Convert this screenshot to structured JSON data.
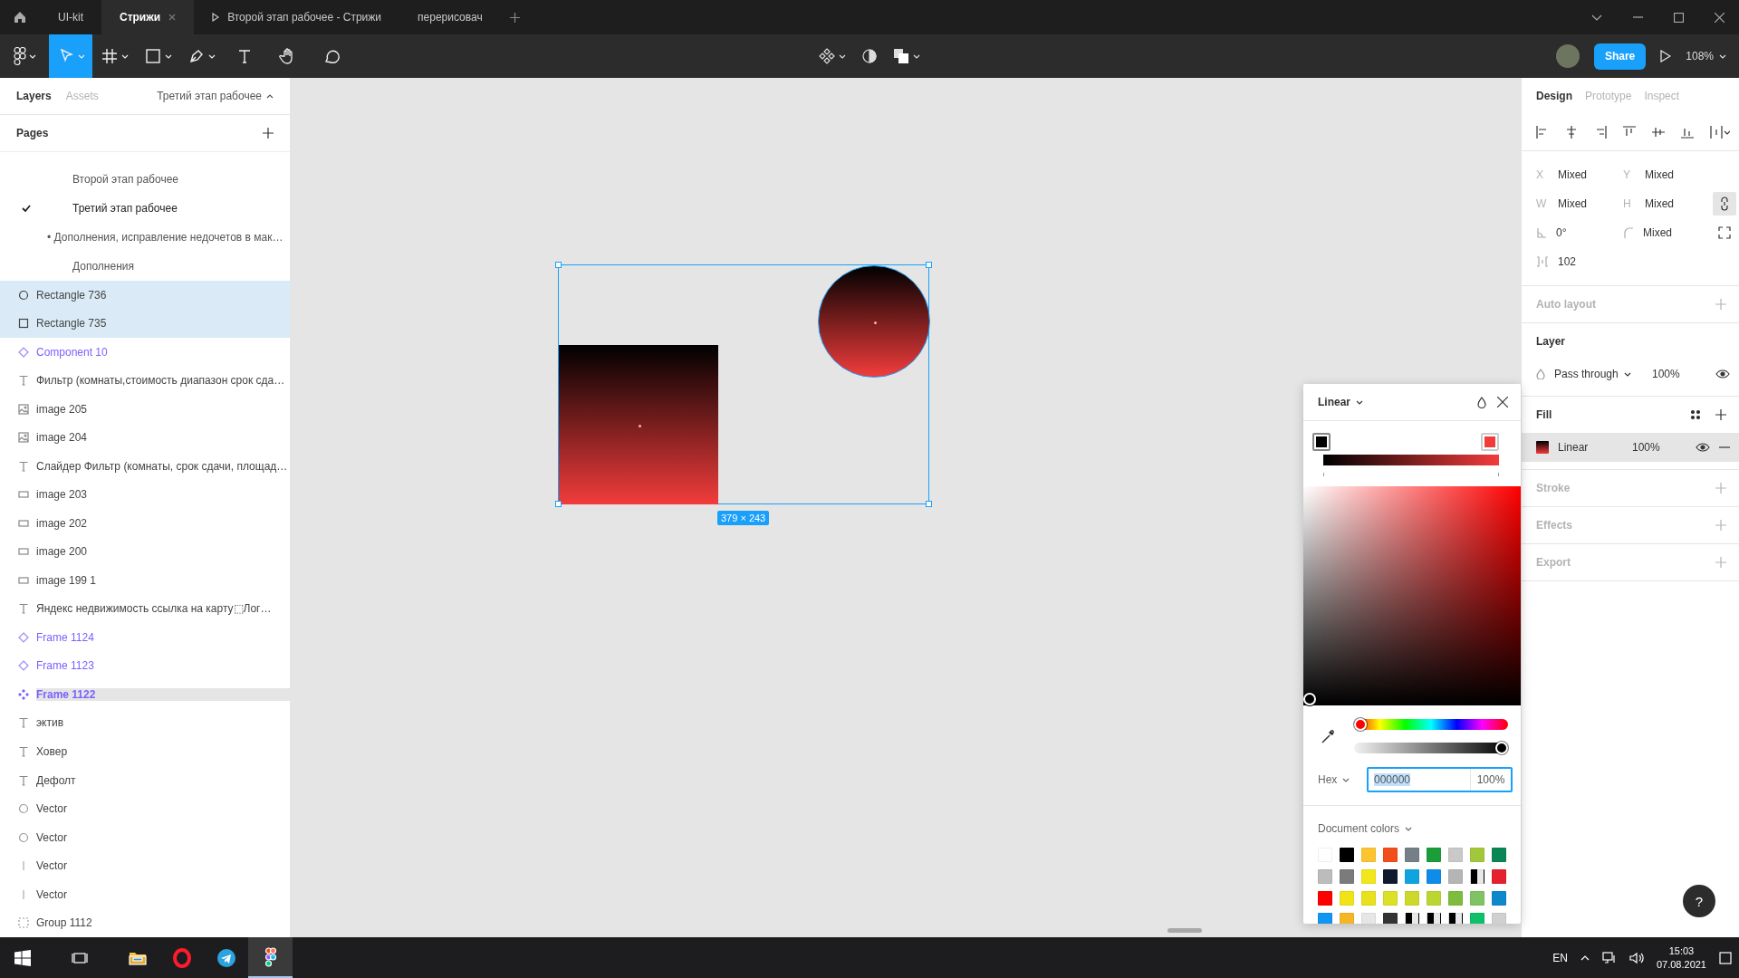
{
  "tabs": [
    {
      "label": "UI-kit",
      "kind": "file",
      "selected": false,
      "closable": false
    },
    {
      "label": "Стрижи",
      "kind": "file",
      "selected": true,
      "closable": true
    },
    {
      "label": "Второй этап рабочее - Стрижи",
      "kind": "prototype",
      "selected": false,
      "closable": false
    },
    {
      "label": "перерисовач",
      "kind": "file",
      "selected": false,
      "closable": false
    }
  ],
  "toolbar": {
    "tools": [
      {
        "kind": "move",
        "selected": true
      },
      {
        "kind": "frame",
        "selected": false
      },
      {
        "kind": "shape",
        "selected": false
      },
      {
        "kind": "pen",
        "selected": false
      },
      {
        "kind": "text",
        "selected": false
      },
      {
        "kind": "hand",
        "selected": false
      },
      {
        "kind": "comment",
        "selected": false
      }
    ],
    "share": "Share",
    "zoom": "108%"
  },
  "left_panel": {
    "tabs": [
      {
        "label": "Layers",
        "selected": true
      },
      {
        "label": "Assets",
        "selected": false
      }
    ],
    "page_picker": "Третий этап рабочее",
    "pages_title": "Pages",
    "pages": [
      {
        "name": "Второй этап рабочее",
        "kind": "page",
        "selected": false
      },
      {
        "name": "Третий этап рабочее",
        "kind": "page",
        "selected": true
      },
      {
        "name": "• Дополнения, исправление недочетов в мак…",
        "kind": "bullet",
        "selected": false
      },
      {
        "name": "Дополнения",
        "kind": "page",
        "selected": false
      }
    ],
    "layers": [
      {
        "name": "Rectangle 736",
        "kind": "ellipse",
        "selected": true
      },
      {
        "name": "Rectangle 735",
        "kind": "rectangle",
        "selected": true
      },
      {
        "name": "Component 10",
        "kind": "component",
        "selected": false
      },
      {
        "name": "Фильтр (комнаты,стоимость диапазон срок сда…",
        "kind": "text",
        "selected": false
      },
      {
        "name": "image 205",
        "kind": "image",
        "selected": false
      },
      {
        "name": "image 204",
        "kind": "image",
        "selected": false
      },
      {
        "name": "Слайдер Фильтр (комнаты, срок сдачи, площад…",
        "kind": "text",
        "selected": false
      },
      {
        "name": "image 203",
        "kind": "frame",
        "selected": false
      },
      {
        "name": "image 202",
        "kind": "frame",
        "selected": false
      },
      {
        "name": "image 200",
        "kind": "frame",
        "selected": false
      },
      {
        "name": "image 199 1",
        "kind": "frame",
        "selected": false
      },
      {
        "name": "Яндекс недвижимость ссылка на карту⬚Лог…",
        "kind": "text",
        "selected": false
      },
      {
        "name": "Frame 1124",
        "kind": "component",
        "selected": false
      },
      {
        "name": "Frame 1123",
        "kind": "component",
        "selected": false
      },
      {
        "name": "Frame 1122",
        "kind": "main-component",
        "selected": false
      },
      {
        "name": "эктив",
        "kind": "text",
        "selected": false
      },
      {
        "name": "Ховер",
        "kind": "text",
        "selected": false
      },
      {
        "name": "Дефолт",
        "kind": "text",
        "selected": false
      },
      {
        "name": "Vector",
        "kind": "ellipse-light",
        "selected": false
      },
      {
        "name": "Vector",
        "kind": "ellipse-light",
        "selected": false
      },
      {
        "name": "Vector",
        "kind": "line",
        "selected": false
      },
      {
        "name": "Vector",
        "kind": "line",
        "selected": false
      },
      {
        "name": "Group 1112",
        "kind": "group",
        "selected": false
      }
    ]
  },
  "canvas": {
    "selection_size": "379 × 243"
  },
  "right_panel": {
    "tabs": [
      {
        "label": "Design",
        "selected": true
      },
      {
        "label": "Prototype",
        "selected": false
      },
      {
        "label": "Inspect",
        "selected": false
      }
    ],
    "fields": [
      {
        "kind": "letter",
        "label": "X",
        "value": "Mixed"
      },
      {
        "kind": "letter",
        "label": "Y",
        "value": "Mixed"
      },
      {
        "kind": "letter",
        "label": "W",
        "value": "Mixed"
      },
      {
        "kind": "letter",
        "label": "H",
        "value": "Mixed"
      },
      {
        "kind": "rotation",
        "value": "0°"
      },
      {
        "kind": "radius",
        "value": "Mixed"
      },
      {
        "kind": "spacing",
        "value": "102"
      }
    ],
    "sections": [
      {
        "kind": "empty",
        "title": "Auto layout"
      },
      {
        "kind": "layer",
        "title": "Layer",
        "blend": "Pass through",
        "opacity": "100%"
      },
      {
        "kind": "fill",
        "title": "Fill",
        "fill_type": "Linear",
        "opacity": "100%"
      },
      {
        "kind": "empty",
        "title": "Stroke"
      },
      {
        "kind": "empty",
        "title": "Effects"
      },
      {
        "kind": "empty",
        "title": "Export"
      }
    ]
  },
  "color_picker": {
    "type": "Linear",
    "stops": [
      {
        "color": "#000000",
        "selected": true
      },
      {
        "color": "#f23c3c",
        "selected": false
      }
    ],
    "hue": {
      "level": 0
    },
    "alpha": {
      "level": 1
    },
    "format": "Hex",
    "hex": "000000",
    "opacity": "100%",
    "document_colors": {
      "title": "Document colors",
      "swatches": [
        {
          "color": "#ffffff",
          "kind": "solid"
        },
        {
          "color": "#000000",
          "kind": "solid"
        },
        {
          "color": "#fcc430",
          "kind": "solid"
        },
        {
          "color": "#f24e1e",
          "kind": "solid"
        },
        {
          "color": "#747f88",
          "kind": "solid"
        },
        {
          "color": "#1b9d3a",
          "kind": "solid"
        },
        {
          "color": "#c9c9c9",
          "kind": "solid"
        },
        {
          "color": "#a1c83a",
          "kind": "solid"
        },
        {
          "color": "#0a8654",
          "kind": "solid"
        },
        {
          "color": "#bcbcbc",
          "kind": "solid"
        },
        {
          "color": "#7b7b7b",
          "kind": "solid"
        },
        {
          "color": "#f1e71b",
          "kind": "solid"
        },
        {
          "color": "#101a2e",
          "kind": "solid"
        },
        {
          "color": "#0fa3e0",
          "kind": "solid"
        },
        {
          "color": "#0d8ce8",
          "kind": "solid"
        },
        {
          "color": "#b5b5b5",
          "kind": "solid"
        },
        {
          "color": "#000000",
          "kind": "split"
        },
        {
          "color": "#e4212c",
          "kind": "solid"
        },
        {
          "color": "#ff0000",
          "kind": "solid"
        },
        {
          "color": "#f0e419",
          "kind": "solid"
        },
        {
          "color": "#e8e11c",
          "kind": "solid"
        },
        {
          "color": "#dde125",
          "kind": "solid"
        },
        {
          "color": "#cdd92a",
          "kind": "solid"
        },
        {
          "color": "#bcd631",
          "kind": "solid"
        },
        {
          "color": "#7fbb3d",
          "kind": "solid"
        },
        {
          "color": "#7fc364",
          "kind": "solid"
        },
        {
          "color": "#0f87cb",
          "kind": "solid"
        },
        {
          "color": "#0e96f0",
          "kind": "solid"
        },
        {
          "color": "#f4b624",
          "kind": "solid"
        },
        {
          "color": "#e6e6e6",
          "kind": "solid"
        },
        {
          "color": "#333333",
          "kind": "solid"
        },
        {
          "color": "#000000",
          "kind": "split"
        },
        {
          "color": "#000000",
          "kind": "split"
        },
        {
          "color": "#000000",
          "kind": "split"
        },
        {
          "color": "#0ec06a",
          "kind": "solid"
        },
        {
          "color": "#d0d0d0",
          "kind": "solid"
        }
      ]
    }
  },
  "help": "?",
  "taskbar": {
    "apps": [
      {
        "kind": "explorer",
        "selected": false
      },
      {
        "kind": "opera",
        "selected": false
      },
      {
        "kind": "telegram",
        "selected": false
      },
      {
        "kind": "figma",
        "selected": true
      }
    ],
    "language": "EN",
    "time": "15:03",
    "date": "07.08.2021"
  }
}
